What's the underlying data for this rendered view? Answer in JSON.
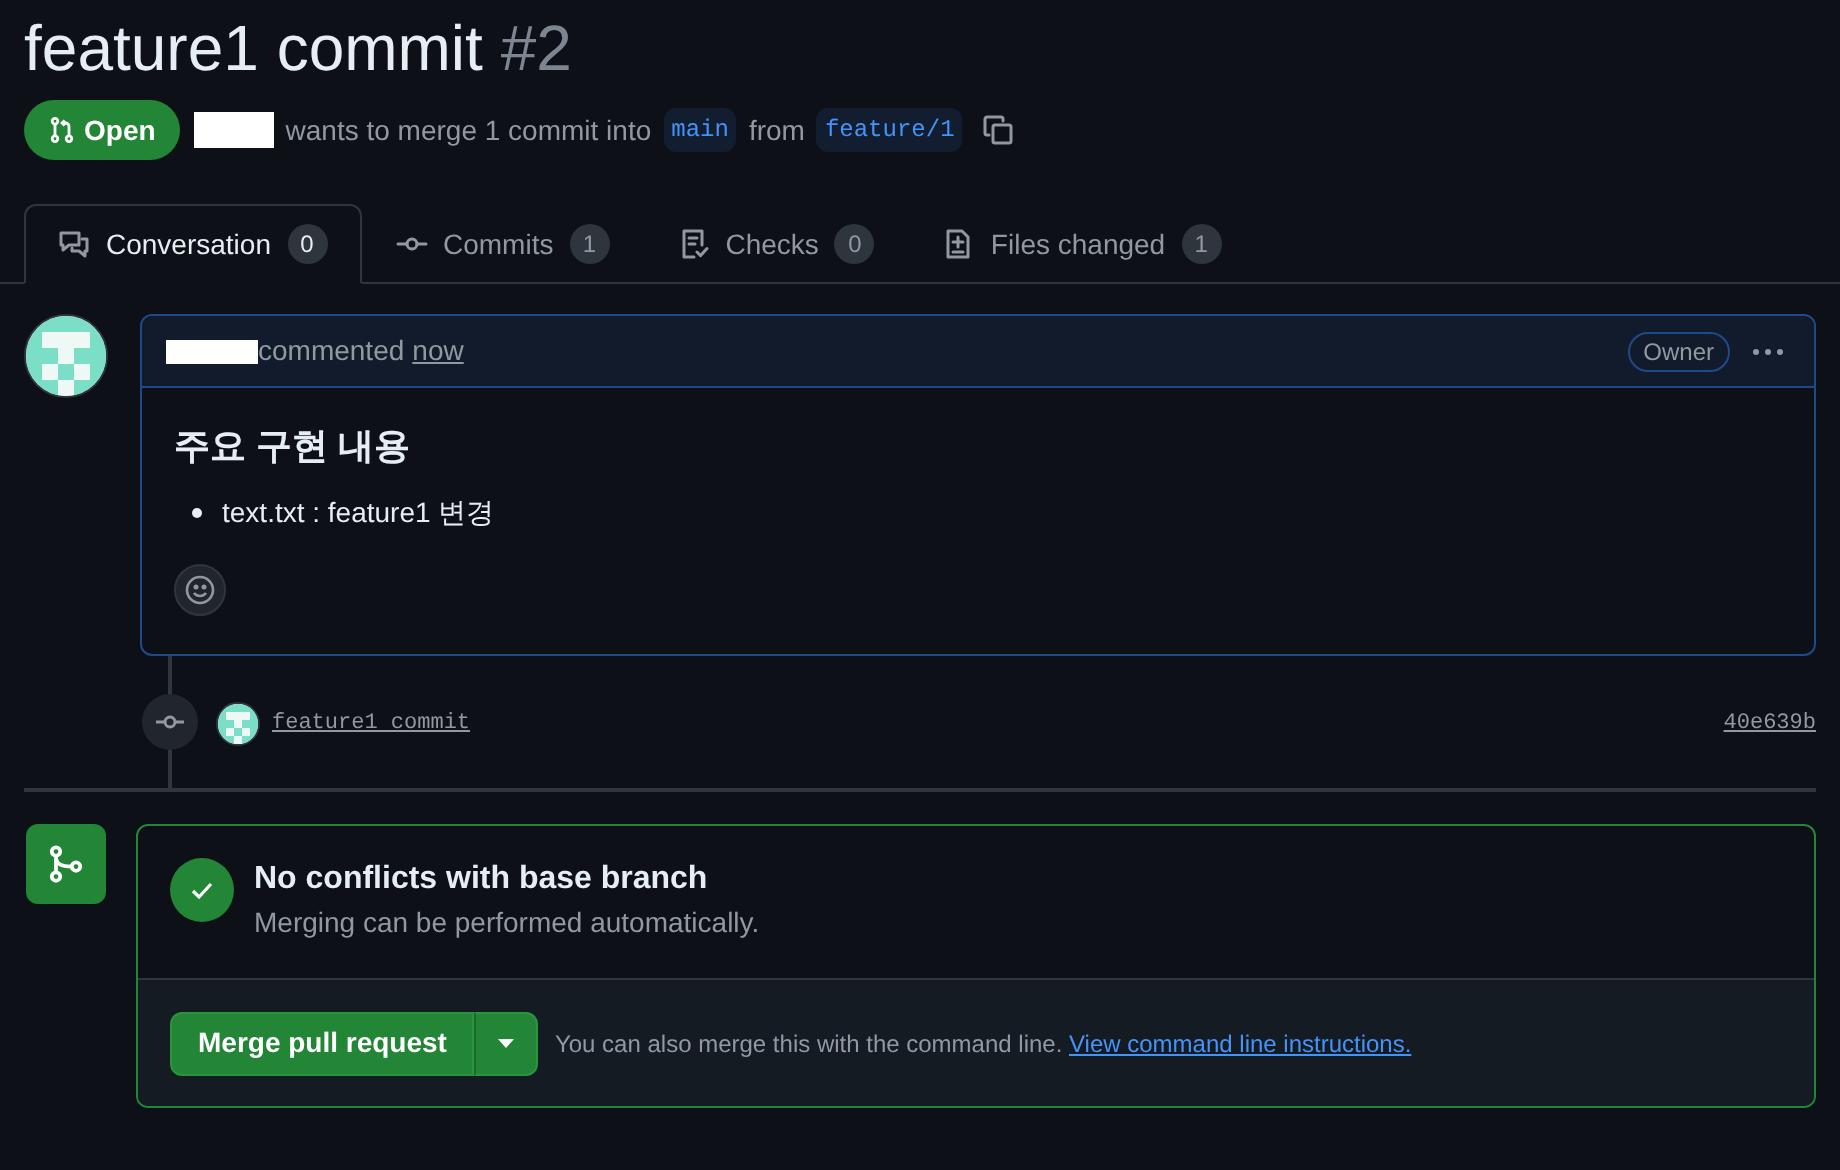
{
  "pr": {
    "title": "feature1 commit",
    "number": "#2",
    "state": {
      "label": "Open",
      "kind": "open"
    },
    "summary": "wants to merge 1 commit into",
    "base": "main",
    "from_word": "from",
    "head": "feature/1"
  },
  "tabs": [
    {
      "label": "Conversation",
      "count": "0",
      "selected": true,
      "kind": "conversation"
    },
    {
      "label": "Commits",
      "count": "1",
      "selected": false,
      "kind": "commit"
    },
    {
      "label": "Checks",
      "count": "0",
      "selected": false,
      "kind": "checks"
    },
    {
      "label": "Files changed",
      "count": "1",
      "selected": false,
      "kind": "files"
    }
  ],
  "comment": {
    "action": "commented",
    "time": "now",
    "role": "Owner",
    "heading": "주요 구현 내용",
    "bullets": [
      "text.txt : feature1 변경"
    ]
  },
  "commit": {
    "message": "feature1 commit",
    "sha": "40e639b"
  },
  "merge": {
    "title": "No conflicts with base branch",
    "subtitle": "Merging can be performed automatically.",
    "button": "Merge pull request",
    "hint": "You can also merge this with the command line.",
    "link": "View command line instructions."
  }
}
